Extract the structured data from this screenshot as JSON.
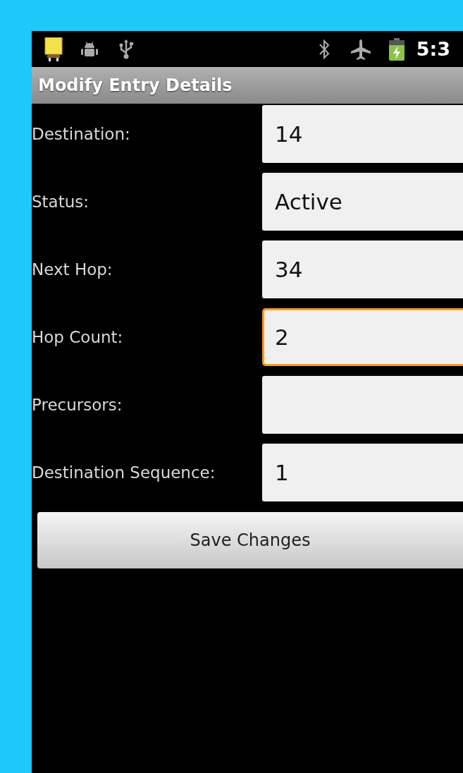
{
  "status_bar": {
    "time": "5:3",
    "battery_charging": true
  },
  "title_bar": {
    "title": "Modify Entry Details"
  },
  "fields": [
    {
      "label": "Destination:",
      "value": "14",
      "focused": false
    },
    {
      "label": "Status:",
      "value": "Active",
      "focused": false
    },
    {
      "label": "Next Hop:",
      "value": "34",
      "focused": false
    },
    {
      "label": "Hop Count:",
      "value": "2",
      "focused": true
    },
    {
      "label": "Precursors:",
      "focused": false
    },
    {
      "label": "Destination Sequence:",
      "value": "1",
      "focused": false
    }
  ],
  "save_button": {
    "label": "Save Changes"
  }
}
